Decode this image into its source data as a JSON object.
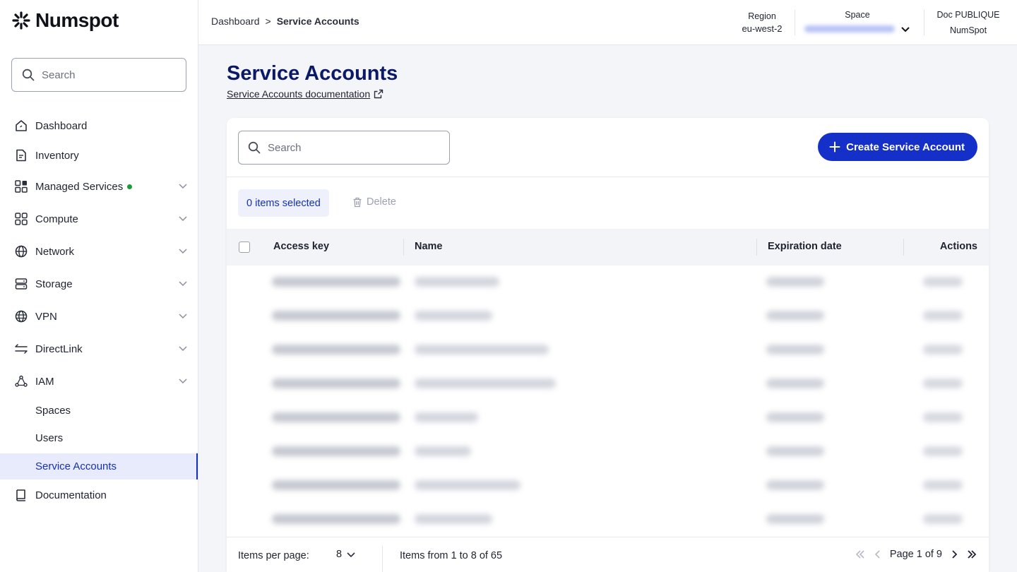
{
  "app": {
    "brand": "Numspot"
  },
  "sidebar": {
    "search_placeholder": "Search",
    "items": [
      {
        "label": "Dashboard",
        "icon": "home-icon"
      },
      {
        "label": "Inventory",
        "icon": "document-icon"
      },
      {
        "label": "Managed Services",
        "icon": "grid-icon",
        "status_dot": "#1c9a3c"
      },
      {
        "label": "Compute",
        "icon": "compute-icon"
      },
      {
        "label": "Network",
        "icon": "globe-icon"
      },
      {
        "label": "Storage",
        "icon": "storage-icon"
      },
      {
        "label": "VPN",
        "icon": "vpn-globe-icon"
      },
      {
        "label": "DirectLink",
        "icon": "directlink-arrows-icon"
      },
      {
        "label": "IAM",
        "icon": "iam-icon"
      }
    ],
    "iam_sub": [
      "Spaces",
      "Users",
      "Service Accounts"
    ],
    "documentation": "Documentation",
    "active_item": "Service Accounts"
  },
  "topbar": {
    "breadcrumb_root": "Dashboard",
    "breadcrumb_sep": ">",
    "breadcrumb_current": "Service Accounts",
    "region_label": "Region",
    "region_value": "eu-west-2",
    "space_label": "Space",
    "org_label": "Doc PUBLIQUE",
    "org_value": "NumSpot"
  },
  "main": {
    "title": "Service Accounts",
    "doc_link": "Service Accounts documentation",
    "search_placeholder": "Search",
    "create_button": "Create Service Account",
    "selected_chip": "0 items selected",
    "delete_button": "Delete",
    "columns": [
      "Access key",
      "Name",
      "Expiration date",
      "Actions"
    ],
    "row_count_visible": 8,
    "rows_redacted": true
  },
  "pagination": {
    "items_per_page_label": "Items per page:",
    "items_per_page_value": "8",
    "range_text": "Items from 1 to 8 of 65",
    "page_text": "Page 1 of 9"
  },
  "colors": {
    "primary": "#1530c8",
    "title": "#0c1a66",
    "active_bg": "#e8ebfb",
    "status_green": "#1c9a3c"
  }
}
